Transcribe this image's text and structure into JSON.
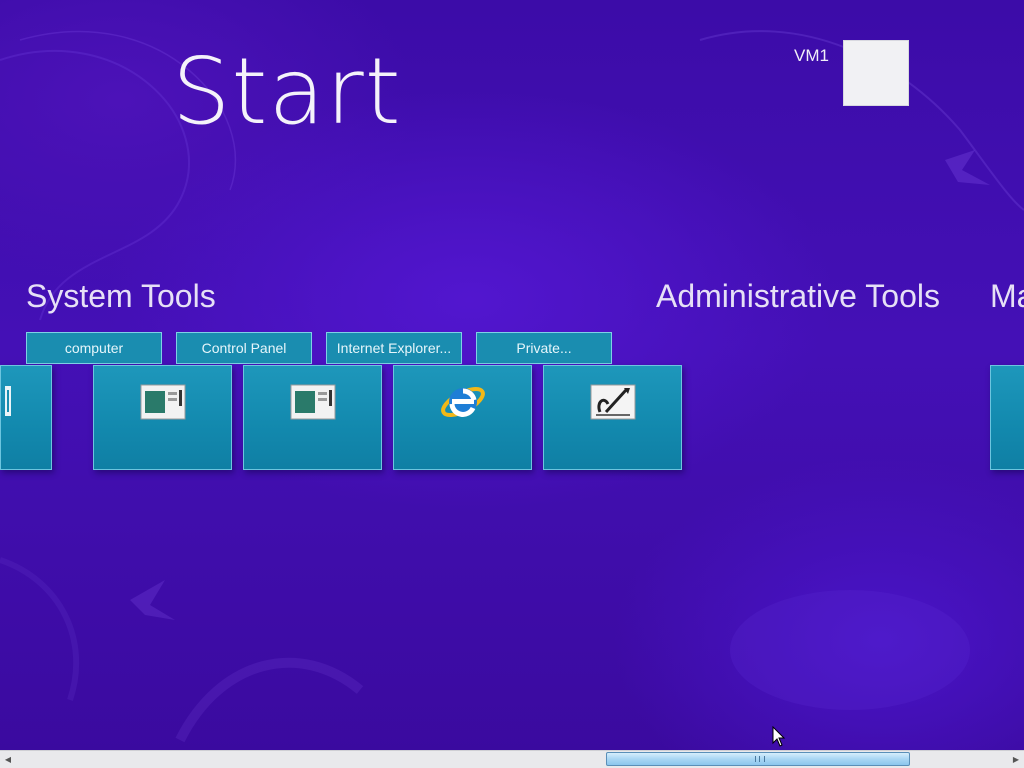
{
  "start": {
    "title": "Start"
  },
  "user": {
    "name": "VM1"
  },
  "groups": [
    {
      "title": "System Tools"
    },
    {
      "title": "Administrative Tools"
    },
    {
      "title": "Ma"
    }
  ],
  "system_tools": {
    "labels": [
      "computer",
      "Control Panel",
      "Internet Explorer...",
      "Private..."
    ],
    "tiles": [
      {
        "icon": "partial-tile-icon"
      },
      {
        "icon": "window-icon"
      },
      {
        "icon": "window-icon"
      },
      {
        "icon": "internet-explorer-icon"
      },
      {
        "icon": "pen-icon"
      }
    ]
  },
  "colors": {
    "background": "#3a0aa8",
    "tile": "#1a8db0",
    "tile_border": "#6cc5df",
    "scroll_thumb": "#a9d6f4"
  }
}
